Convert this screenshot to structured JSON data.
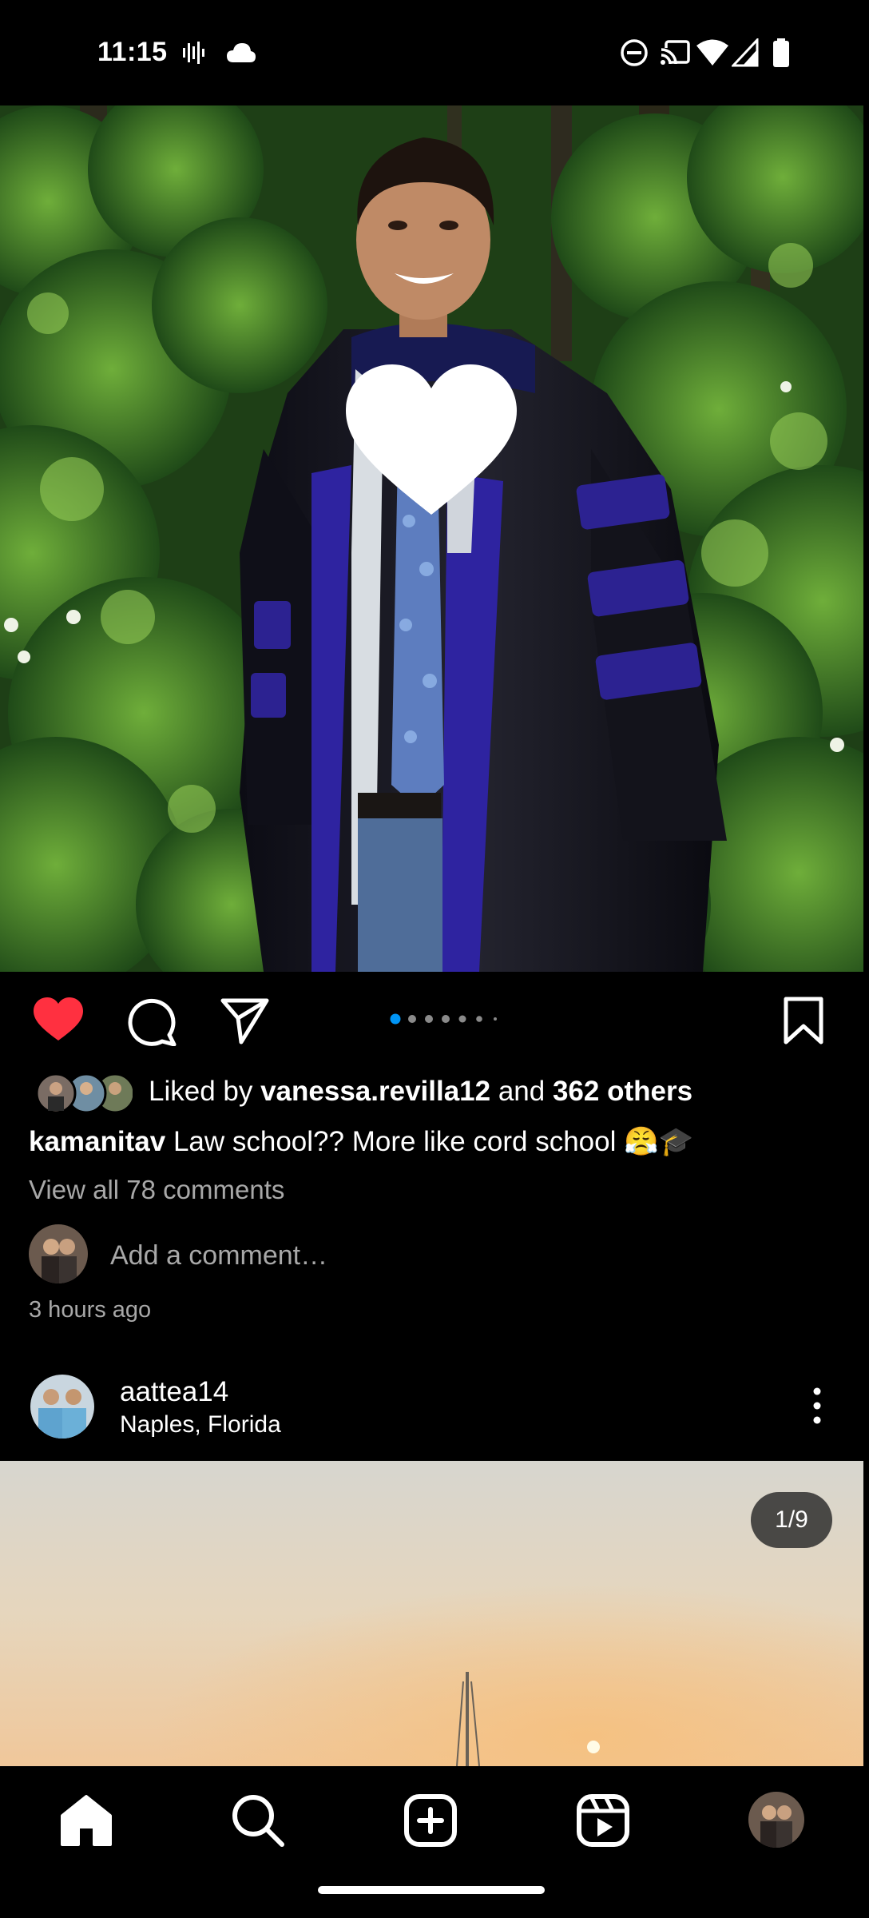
{
  "status_bar": {
    "time": "11:15",
    "left_icons": [
      "voicemail-icon",
      "cloud-icon"
    ],
    "right_icons": [
      "do-not-disturb-icon",
      "cast-icon",
      "wifi-icon",
      "signal-icon",
      "battery-icon"
    ]
  },
  "post": {
    "image_description": "graduation-photo",
    "overlay_icon": "heart-icon",
    "actions": {
      "like_icon": "heart-filled-icon",
      "comment_icon": "comment-icon",
      "share_icon": "send-icon",
      "save_icon": "bookmark-icon",
      "liked": true,
      "like_color": "#ff3040"
    },
    "carousel_dots": {
      "count": 6,
      "active_index": 0,
      "active_color": "#0095f6"
    },
    "liked_by_prefix": "Liked by ",
    "liked_by_user": "vanessa.revilla12",
    "liked_by_and": " and ",
    "liked_by_others": "362 others",
    "caption_user": "kamanitav",
    "caption_text": " Law school?? More like cord school 😤🎓",
    "view_comments": "View all 78 comments",
    "add_comment_placeholder": "Add a comment…",
    "time_ago": "3 hours ago"
  },
  "next_post": {
    "username": "aattea14",
    "location": "Naples, Florida",
    "counter": "1/9",
    "more_icon": "more-vertical-icon"
  },
  "bottom_nav": {
    "items": [
      "home-icon",
      "search-icon",
      "create-icon",
      "reels-icon",
      "profile-avatar"
    ],
    "active": "home-icon"
  }
}
